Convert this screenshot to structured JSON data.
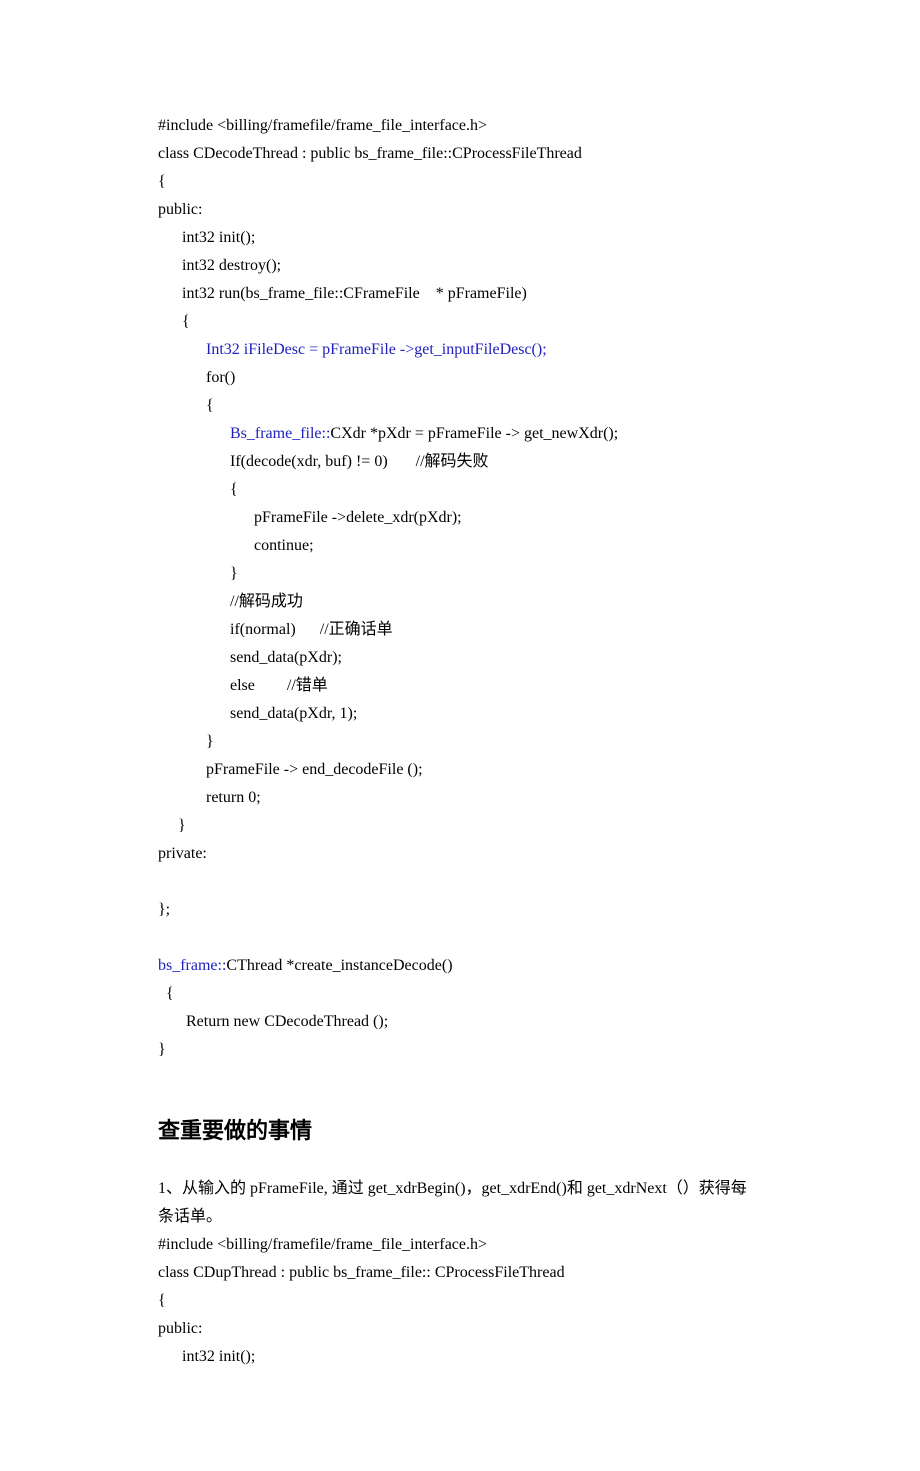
{
  "code1": {
    "l01": "#include <billing/framefile/frame_file_interface.h>",
    "l02": "class CDecodeThread : public bs_frame_file::CProcessFileThread",
    "l03": "{",
    "l04": "public:",
    "l05": "      int32 init();",
    "l06": "      int32 destroy();",
    "l07": "      int32 run(bs_frame_file::CFrameFile    * pFrameFile)",
    "l08": "      {",
    "l09a": "            ",
    "l09b": "Int32 iFileDesc = pFrameFile ->get_inputFileDesc();",
    "l10": "            for()",
    "l11": "            {",
    "l12a": "                  ",
    "l12b": "Bs_frame_file::",
    "l12c": "CXdr *pXdr = pFrameFile -> get_newXdr();",
    "l13": "                  If(decode(xdr, buf) != 0)       //解码失败",
    "l14": "                  {",
    "l15": "                        pFrameFile ->delete_xdr(pXdr);",
    "l16": "                        continue;",
    "l17": "                  }",
    "l18": "                  //解码成功",
    "l19": "                  if(normal)      //正确话单",
    "l20": "                  send_data(pXdr);",
    "l21": "                  else        //错单",
    "l22": "                  send_data(pXdr, 1);",
    "l23": "            }",
    "l24": "            pFrameFile -> end_decodeFile ();",
    "l25": "            return 0;",
    "l26": "     }",
    "l27": "private:",
    "l28": "",
    "l29": "};",
    "l30": "",
    "l31a": "bs_frame::",
    "l31b": "CThread *create_instanceDecode()",
    "l32": "  {",
    "l33": "       Return new CDecodeThread ();",
    "l34": "}"
  },
  "heading": "查重要做的事情",
  "para1": "1、从输入的 pFrameFile,  通过 get_xdrBegin()，get_xdrEnd()和 get_xdrNext（）获得每条话单。",
  "code2": {
    "l01": "#include <billing/framefile/frame_file_interface.h>",
    "l02": "class CDupThread : public bs_frame_file:: CProcessFileThread",
    "l03": "{",
    "l04": "public:",
    "l05": "      int32 init();"
  }
}
